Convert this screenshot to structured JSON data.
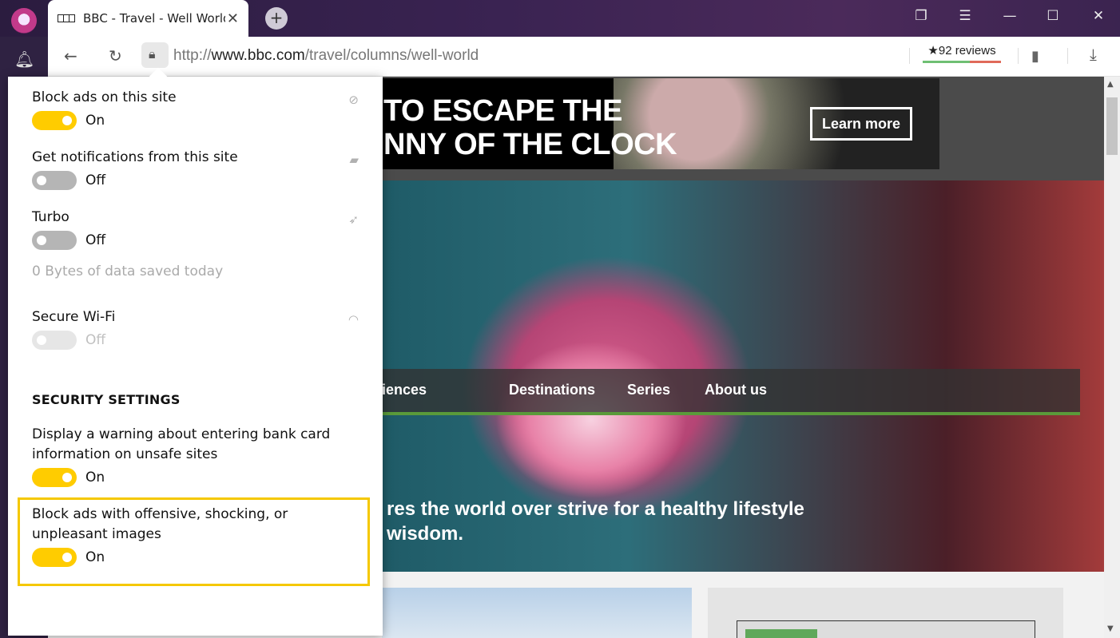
{
  "browser": {
    "tab_title": "BBC - Travel - Well World",
    "tab_close": "✕",
    "new_tab": "+",
    "url_prefix": "http://",
    "url_domain": "www.bbc.com",
    "url_path": "/travel/columns/well-world",
    "reviews": "★92 reviews"
  },
  "page": {
    "ad_line1": "TO ESCAPE THE",
    "ad_line2": "NNY OF THE CLOCK",
    "ad_button": "Learn more",
    "nav": [
      "iences",
      "Destinations",
      "Series",
      "About us"
    ],
    "caption_line1": "res the world over strive for a healthy lifestyle",
    "caption_line2": "wisdom."
  },
  "panel": {
    "block_ads": {
      "label": "Block ads on this site",
      "state": "On"
    },
    "notifications": {
      "label": "Get notifications from this site",
      "state": "Off"
    },
    "turbo": {
      "label": "Turbo",
      "state": "Off",
      "saved": "0 Bytes of data saved today"
    },
    "wifi": {
      "label": "Secure Wi-Fi",
      "state": "Off"
    },
    "security_title": "SECURITY SETTINGS",
    "bank_warning": {
      "label_line1": "Display a warning about entering bank card",
      "label_line2": "information on unsafe sites",
      "state": "On"
    },
    "offensive": {
      "label_line1": "Block ads with offensive, shocking, or",
      "label_line2": "unpleasant images",
      "state": "On"
    }
  },
  "colors": {
    "toggle_on": "#ffcc00",
    "highlight": "#f5c800",
    "nav_underline": "#5a9a3a"
  }
}
